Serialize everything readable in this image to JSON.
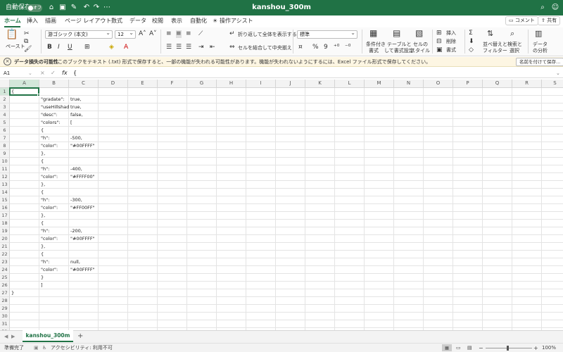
{
  "titlebar": {
    "autosave_label": "自動保存",
    "autosave_state": "オフ",
    "document_title": "kanshou_300m",
    "bg_color": "#207245"
  },
  "menu": {
    "tabs": [
      "ホーム",
      "挿入",
      "描画",
      "ページ レイアウト",
      "数式",
      "データ",
      "校閲",
      "表示",
      "自動化"
    ],
    "assist": "操作アシスト",
    "comment_button": "コメント",
    "share_button": "共有"
  },
  "ribbon": {
    "paste": "ペースト",
    "font_name": "游ゴシック (本文)",
    "font_size": "12",
    "wrap_text": "折り返して全体を表示する",
    "merge_center": "セルを結合して中央揃え",
    "number_format": "標準",
    "conditional_format": [
      "条件付き",
      "書式"
    ],
    "table_format": [
      "テーブルと",
      "して書式設定"
    ],
    "cell_styles": [
      "セルの",
      "スタイル"
    ],
    "insert": "挿入",
    "delete": "削除",
    "format": "書式",
    "sort_filter": [
      "並べ替えと",
      "フィルター"
    ],
    "find_select": [
      "検索と",
      "選択"
    ],
    "analyze": [
      "データ",
      "の分析"
    ],
    "bold": "B",
    "italic": "I",
    "underline": "U",
    "percent": "%",
    "comma": "9"
  },
  "warning": {
    "title": "データ損失の可能性",
    "message": "このブックをテキスト (.txt) 形式で保存すると、一部の機能が失われる可能性があります。機能が失われないようにするには、Excel ファイル形式で保存してください。",
    "button": "名前を付けて保存..."
  },
  "formula_bar": {
    "name_box": "A1",
    "fx": "fx",
    "content": "{"
  },
  "columns": [
    "A",
    "B",
    "C",
    "D",
    "E",
    "F",
    "G",
    "H",
    "I",
    "J",
    "K",
    "L",
    "M",
    "N",
    "O",
    "P",
    "Q",
    "R",
    "S"
  ],
  "rows": [
    "1",
    "2",
    "3",
    "4",
    "5",
    "6",
    "7",
    "8",
    "9",
    "10",
    "11",
    "12",
    "13",
    "14",
    "15",
    "16",
    "17",
    "18",
    "19",
    "20",
    "21",
    "22",
    "23",
    "24",
    "25",
    "26",
    "27",
    "28",
    "29",
    "30",
    "31",
    "32"
  ],
  "cells": {
    "A1": "{",
    "B2": "\"gradate\":",
    "C2": "true,",
    "B3": "\"useHillshade\":",
    "C3": "true,",
    "B4": "\"desc\":",
    "C4": "false,",
    "B5": "\"colors\":",
    "C5": "[",
    "B6": "{",
    "B7": "\"h\":",
    "C7": "-500,",
    "B8": "\"color\":",
    "C8": "\"#00FFFF\"",
    "B9": "},",
    "B10": "{",
    "B11": "\"h\":",
    "C11": "-400,",
    "B12": "\"color\":",
    "C12": "\"#FFFF00\"",
    "B13": "},",
    "B14": "{",
    "B15": "\"h\":",
    "C15": "-300,",
    "B16": "\"color\":",
    "C16": "\"#FF00FF\"",
    "B17": "},",
    "B18": "{",
    "B19": "\"h\":",
    "C19": "-200,",
    "B20": "\"color\":",
    "C20": "\"#00FFFF\"",
    "B21": "},",
    "B22": "{",
    "B23": "\"h\":",
    "C23": "null,",
    "B24": "\"color\":",
    "C24": "\"#00FFFF\"",
    "B25": "}",
    "B26": "]",
    "A27": "}"
  },
  "sheet_tabs": {
    "active": "kanshou_300m",
    "add": "+"
  },
  "status": {
    "ready": "準備完了",
    "accessibility": "アクセシビリティ: 利用不可",
    "zoom": "100%"
  }
}
